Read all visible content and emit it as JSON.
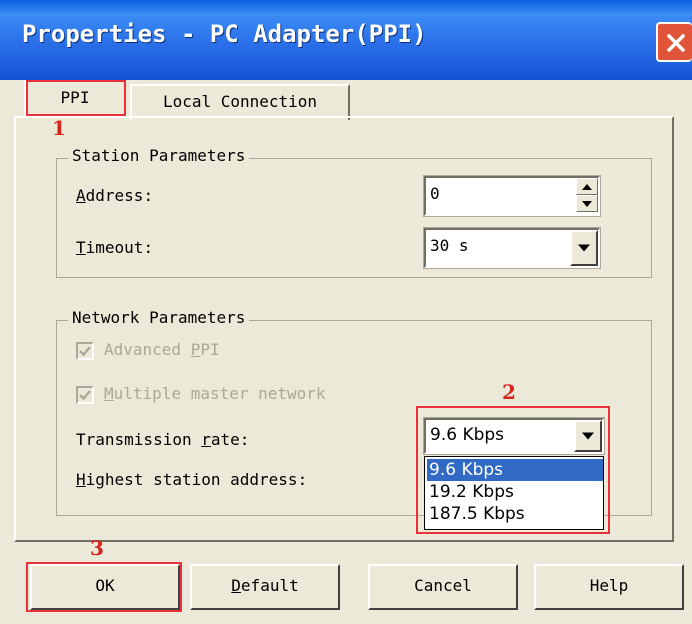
{
  "window": {
    "title": "Properties - PC Adapter(PPI)",
    "close_icon": "close-x-icon"
  },
  "tabs": [
    {
      "label": "PPI",
      "selected": true
    },
    {
      "label": "Local Connection",
      "selected": false
    }
  ],
  "annotations": {
    "marker_1": "1",
    "marker_2": "2",
    "marker_3": "3",
    "highlight_color": "#e8313a"
  },
  "station": {
    "legend": "Station Parameters",
    "address_label_u": "A",
    "address_label_rest": "ddress:",
    "address_value": "0",
    "timeout_label_u": "T",
    "timeout_label_rest": "imeout:",
    "timeout_value": "30 s"
  },
  "network": {
    "legend": "Network Parameters",
    "advanced_ppi_pre": "Advanced ",
    "advanced_ppi_u": "P",
    "advanced_ppi_post": "PI",
    "advanced_ppi_checked": true,
    "multi_master_u": "M",
    "multi_master_rest": "ultiple master network",
    "multi_master_checked": true,
    "rate_label_pre": "Transmission ",
    "rate_label_u": "r",
    "rate_label_post": "ate:",
    "rate_value": "9.6 Kbps",
    "rate_options": [
      "9.6 Kbps",
      "19.2 Kbps",
      "187.5 Kbps"
    ],
    "highest_label_u": "H",
    "highest_label_rest": "ighest station address:"
  },
  "buttons": {
    "ok": "OK",
    "default_u": "D",
    "default_rest": "efault",
    "cancel": "Cancel",
    "help": "Help"
  }
}
